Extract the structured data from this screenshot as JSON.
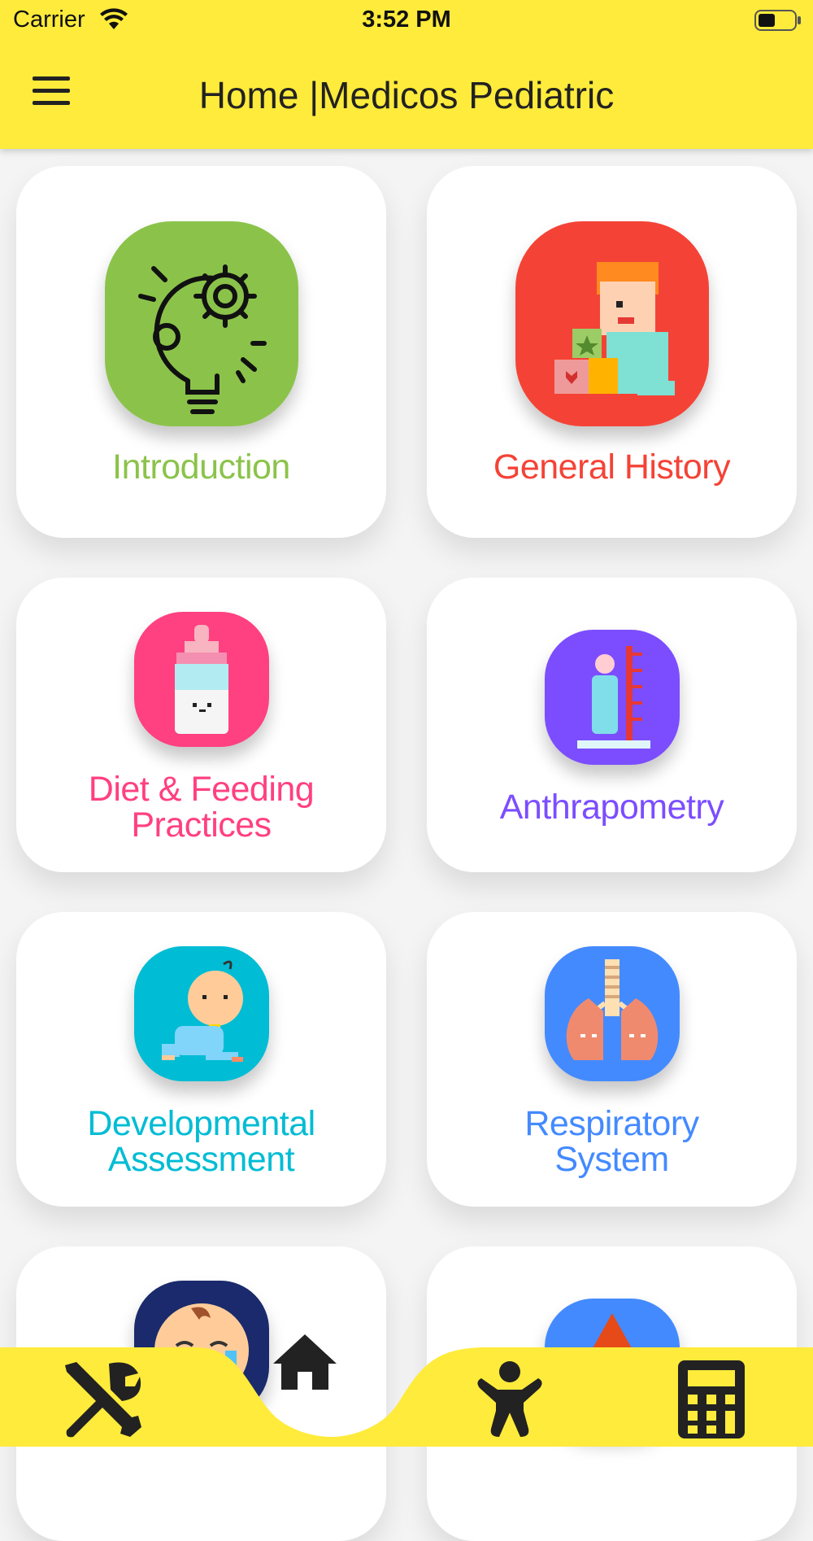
{
  "status_bar": {
    "carrier": "Carrier",
    "time": "3:52 PM"
  },
  "header": {
    "title": "Home |Medicos Pediatric",
    "menu_icon": "hamburger-menu-icon",
    "background": "#ffeb3b"
  },
  "cards": [
    {
      "label": "Introduction",
      "color": "#8bc34a",
      "icon": "lightbulb-gears-icon"
    },
    {
      "label": "General History",
      "color": "#f44336",
      "icon": "child-with-blocks-icon"
    },
    {
      "label_line1": "Diet & Feeding",
      "label_line2": "Practices",
      "color": "#ff4081",
      "icon": "baby-bottle-icon"
    },
    {
      "label": "Anthrapometry",
      "color": "#7c4dff",
      "icon": "height-measure-icon"
    },
    {
      "label_line1": "Developmental",
      "label_line2": "Assessment",
      "color": "#00bcd4",
      "icon": "crawling-baby-icon"
    },
    {
      "label_line1": "Respiratory",
      "label_line2": "System",
      "color": "#448aff",
      "icon": "lungs-icon"
    },
    {
      "color": "#1a2a6c",
      "icon": "crying-baby-icon"
    },
    {
      "color": "#448aff",
      "icon": "drop-icon"
    }
  ],
  "bottom_nav": {
    "items": [
      "tools-icon",
      "home-icon",
      "baby-icon",
      "calculator-icon"
    ],
    "active": "home-icon",
    "background": "#ffeb3b"
  }
}
